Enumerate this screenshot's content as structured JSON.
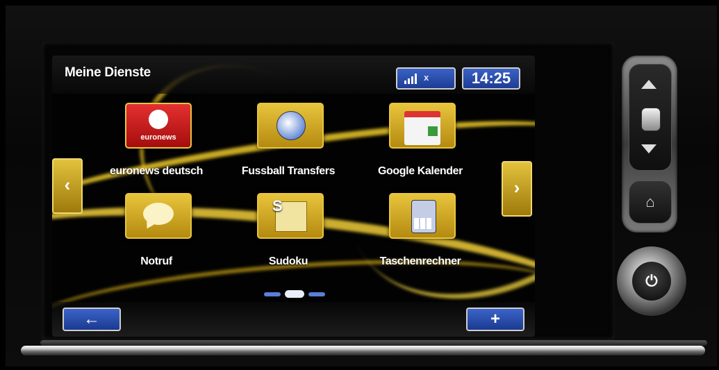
{
  "header": {
    "title": "Meine Dienste",
    "signal_icon": "signal-bars-icon",
    "signal_status": "x",
    "clock": "14:25"
  },
  "apps": [
    {
      "label": "euronews deutsch",
      "icon_text": "euronews",
      "icon": "euronews-logo-icon"
    },
    {
      "label": "Fussball Transfers",
      "icon": "soccer-ball-icon"
    },
    {
      "label": "Google Kalender",
      "icon": "calendar-icon"
    },
    {
      "label": "Notruf",
      "icon": "speech-bubble-icon"
    },
    {
      "label": "Sudoku",
      "icon_text": "S",
      "icon": "sudoku-icon"
    },
    {
      "label": "Taschenrechner",
      "icon": "calculator-icon"
    }
  ],
  "navigation": {
    "prev_glyph": "‹",
    "next_glyph": "›",
    "back_glyph": "←",
    "add_glyph": "+",
    "page_count": 3,
    "active_page": 2
  },
  "hardware": {
    "home_glyph": "⌂",
    "power_glyph": "⏻"
  },
  "colors": {
    "accent_gold": "#e6c540",
    "button_blue": "#2a4fb0"
  }
}
